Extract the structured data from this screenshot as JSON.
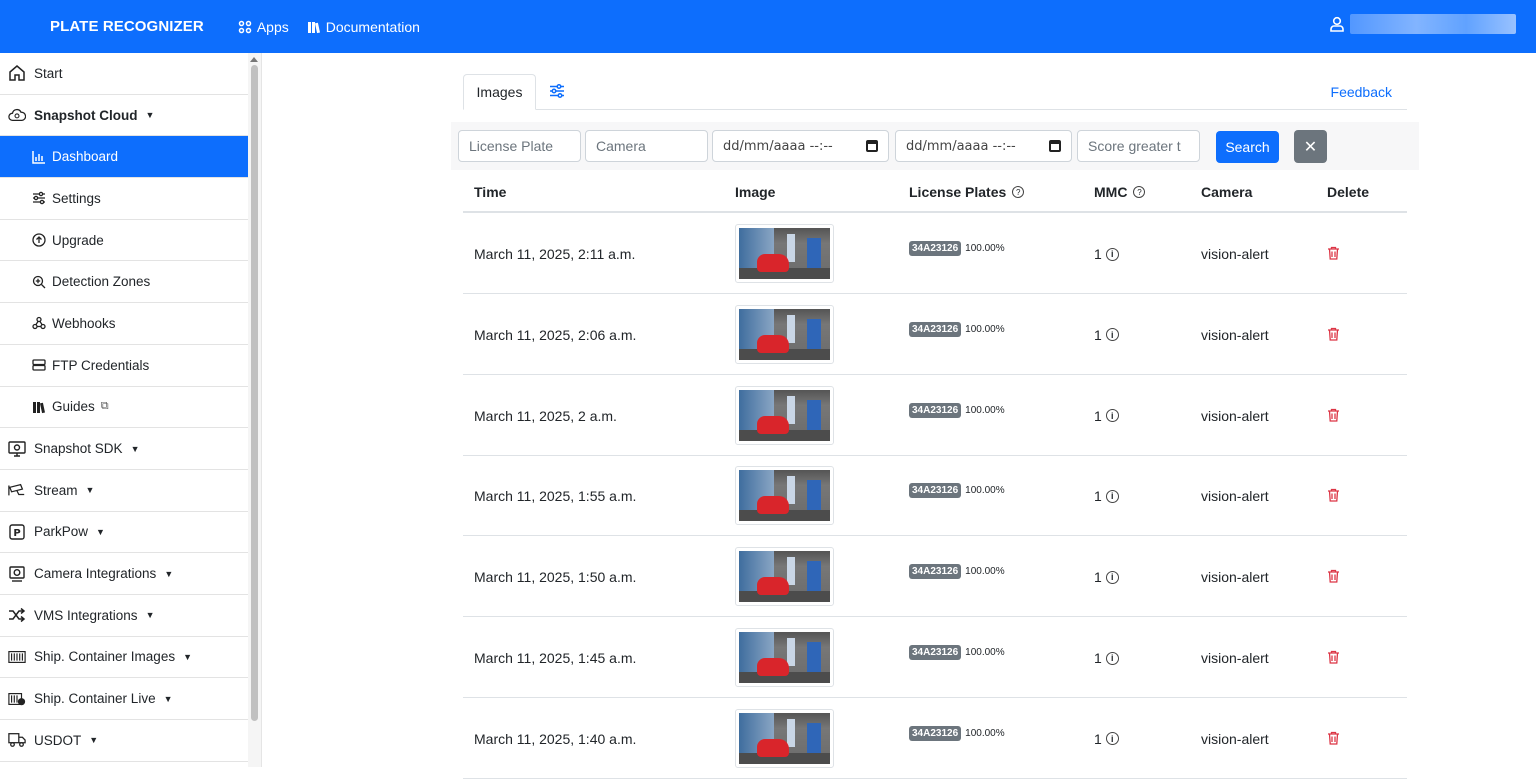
{
  "navbar": {
    "brand": "PLATE RECOGNIZER",
    "apps_label": "Apps",
    "docs_label": "Documentation",
    "accent_color": "#0d6efd"
  },
  "sidebar": {
    "items": [
      {
        "label": "Start",
        "icon": "home-icon"
      },
      {
        "label": "Snapshot Cloud",
        "icon": "cloud-icon"
      },
      {
        "label": "Dashboard",
        "icon": "chart-icon"
      },
      {
        "label": "Settings",
        "icon": "sliders-icon"
      },
      {
        "label": "Upgrade",
        "icon": "upgrade-icon"
      },
      {
        "label": "Detection Zones",
        "icon": "zoom-icon"
      },
      {
        "label": "Webhooks",
        "icon": "webhook-icon"
      },
      {
        "label": "FTP Credentials",
        "icon": "server-icon"
      },
      {
        "label": "Guides",
        "icon": "books-icon"
      },
      {
        "label": "Snapshot SDK",
        "icon": "monitor-icon"
      },
      {
        "label": "Stream",
        "icon": "camera-icon"
      },
      {
        "label": "ParkPow",
        "icon": "parking-icon"
      },
      {
        "label": "Camera Integrations",
        "icon": "webcam-icon"
      },
      {
        "label": "VMS Integrations",
        "icon": "shuffle-icon"
      },
      {
        "label": "Ship. Container Images",
        "icon": "container-icon"
      },
      {
        "label": "Ship. Container Live",
        "icon": "container-live-icon"
      },
      {
        "label": "USDOT",
        "icon": "truck-icon"
      }
    ]
  },
  "main": {
    "tab_label": "Images",
    "feedback_label": "Feedback",
    "filters": {
      "plate_placeholder": "License Plate",
      "camera_placeholder": "Camera",
      "date_from": "dd/mm/aaaa --:--",
      "date_to": "dd/mm/aaaa --:--",
      "score_placeholder": "Score greater t",
      "search_label": "Search",
      "clear_label": "✕"
    },
    "columns": {
      "time": "Time",
      "image": "Image",
      "plates": "License Plates",
      "mmc": "MMC",
      "camera": "Camera",
      "delete": "Delete"
    },
    "rows": [
      {
        "time": "March 11, 2025, 2:11 a.m.",
        "plate": "34A23126",
        "score": "100.00%",
        "mmc": "1",
        "camera": "vision-alert"
      },
      {
        "time": "March 11, 2025, 2:06 a.m.",
        "plate": "34A23126",
        "score": "100.00%",
        "mmc": "1",
        "camera": "vision-alert"
      },
      {
        "time": "March 11, 2025, 2 a.m.",
        "plate": "34A23126",
        "score": "100.00%",
        "mmc": "1",
        "camera": "vision-alert"
      },
      {
        "time": "March 11, 2025, 1:55 a.m.",
        "plate": "34A23126",
        "score": "100.00%",
        "mmc": "1",
        "camera": "vision-alert"
      },
      {
        "time": "March 11, 2025, 1:50 a.m.",
        "plate": "34A23126",
        "score": "100.00%",
        "mmc": "1",
        "camera": "vision-alert"
      },
      {
        "time": "March 11, 2025, 1:45 a.m.",
        "plate": "34A23126",
        "score": "100.00%",
        "mmc": "1",
        "camera": "vision-alert"
      },
      {
        "time": "March 11, 2025, 1:40 a.m.",
        "plate": "34A23126",
        "score": "100.00%",
        "mmc": "1",
        "camera": "vision-alert"
      }
    ]
  }
}
